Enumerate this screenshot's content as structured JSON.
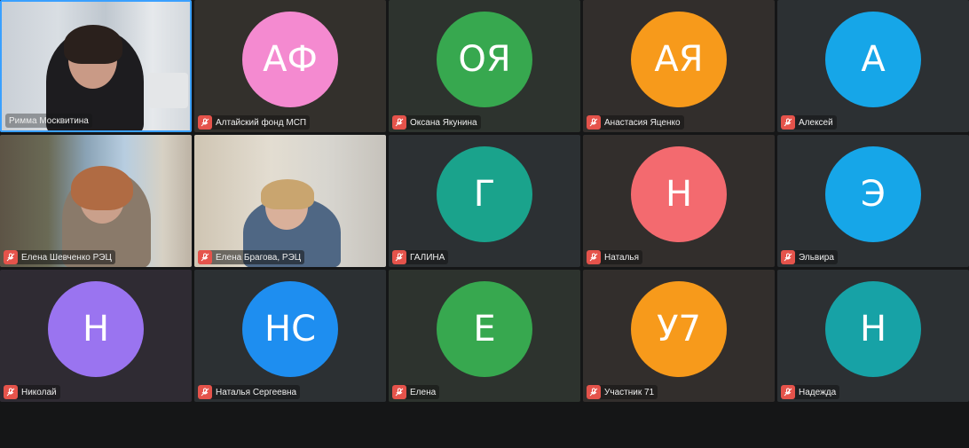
{
  "participants": [
    {
      "name": "Римма Москвитина",
      "initials": "",
      "video": true,
      "muted": false,
      "active": true
    },
    {
      "name": "Алтайский фонд МСП",
      "initials": "АФ",
      "color": "#f48ad0",
      "muted": true
    },
    {
      "name": "Оксана Якунина",
      "initials": "ОЯ",
      "color": "#37a84f",
      "muted": true
    },
    {
      "name": "Анастасия Яценко",
      "initials": "АЯ",
      "color": "#f79a1b",
      "muted": true
    },
    {
      "name": "Алексей",
      "initials": "А",
      "color": "#16a6e8",
      "muted": true
    },
    {
      "name": "Елена Шевченко РЭЦ",
      "initials": "",
      "video": true,
      "muted": true
    },
    {
      "name": "Елена Брагова, РЭЦ",
      "initials": "",
      "video": true,
      "muted": true
    },
    {
      "name": "ГАЛИНА",
      "initials": "Г",
      "color": "#1aa38c",
      "muted": true
    },
    {
      "name": "Наталья",
      "initials": "Н",
      "color": "#f36a6f",
      "muted": true
    },
    {
      "name": "Эльвира",
      "initials": "Э",
      "color": "#16a6e8",
      "muted": true
    },
    {
      "name": "Николай",
      "initials": "Н",
      "color": "#9a74f0",
      "muted": true
    },
    {
      "name": "Наталья Сергеевна",
      "initials": "НС",
      "color": "#1e8ef0",
      "muted": true
    },
    {
      "name": "Елена",
      "initials": "Е",
      "color": "#37a84f",
      "muted": true
    },
    {
      "name": "Участник 71",
      "initials": "У7",
      "color": "#f79a1b",
      "muted": true
    },
    {
      "name": "Надежда",
      "initials": "Н",
      "color": "#17a2a6",
      "muted": true
    }
  ],
  "icons": {
    "mic_off": "mic-off-icon"
  }
}
